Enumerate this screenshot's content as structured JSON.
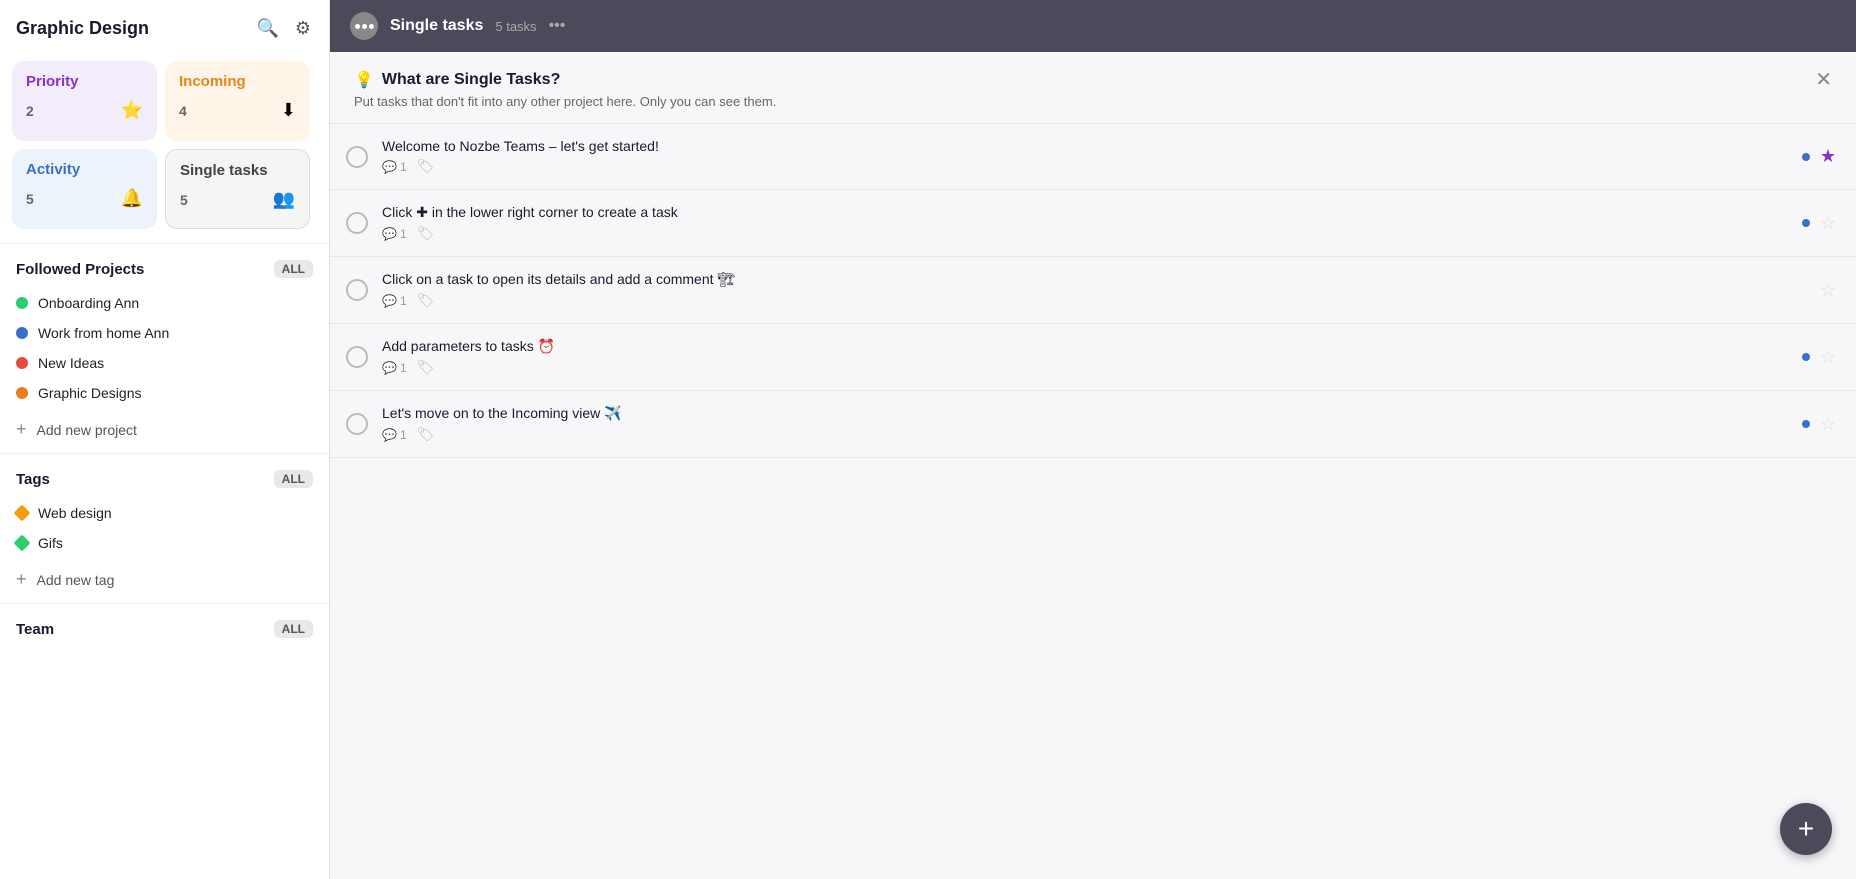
{
  "sidebar": {
    "title": "Graphic Design",
    "cards": [
      {
        "id": "priority",
        "label": "Priority",
        "count": "2",
        "icon": "⭐",
        "colorClass": "card-priority"
      },
      {
        "id": "incoming",
        "label": "Incoming",
        "count": "4",
        "icon": "⬇",
        "colorClass": "card-incoming"
      },
      {
        "id": "activity",
        "label": "Activity",
        "count": "5",
        "icon": "🔔",
        "colorClass": "card-activity"
      },
      {
        "id": "single-tasks",
        "label": "Single tasks",
        "count": "5",
        "icon": "👥",
        "colorClass": "card-single"
      }
    ],
    "followedProjects": {
      "title": "Followed Projects",
      "allLabel": "ALL",
      "items": [
        {
          "label": "Onboarding Ann",
          "color": "#2ecc71"
        },
        {
          "label": "Work from home Ann",
          "color": "#3a6fc9"
        },
        {
          "label": "New Ideas",
          "color": "#e74c3c"
        },
        {
          "label": "Graphic Designs",
          "color": "#e67e22"
        }
      ],
      "addLabel": "Add new project"
    },
    "tags": {
      "title": "Tags",
      "allLabel": "ALL",
      "items": [
        {
          "label": "Web design",
          "color": "#f39c12"
        },
        {
          "label": "Gifs",
          "color": "#2ecc71"
        }
      ],
      "addLabel": "Add new tag"
    },
    "team": {
      "title": "Team",
      "allLabel": "ALL"
    }
  },
  "topbar": {
    "title": "Single tasks",
    "count": "5 tasks",
    "moreIcon": "•••"
  },
  "infoBanner": {
    "icon": "💡",
    "title": "What are Single Tasks?",
    "description": "Put tasks that don't fit into any other project here. Only you can see them."
  },
  "tasks": [
    {
      "name": "Welcome to Nozbe Teams – let's get started!",
      "comments": "1",
      "starred": true,
      "hasDot": true
    },
    {
      "name": "Click ✚ in the lower right corner to create a task",
      "comments": "1",
      "starred": false,
      "hasDot": true
    },
    {
      "name": "Click on a task to open its details and add a comment 🏗",
      "comments": "1",
      "starred": false,
      "hasDot": false
    },
    {
      "name": "Add parameters to tasks ⏰",
      "comments": "1",
      "starred": false,
      "hasDot": true
    },
    {
      "name": "Let's move on to the Incoming view ✈️",
      "comments": "1",
      "starred": false,
      "hasDot": true
    }
  ],
  "fab": {
    "icon": "+"
  },
  "icons": {
    "search": "🔍",
    "gear": "⚙",
    "comment": "💬",
    "tag": "🏷"
  }
}
